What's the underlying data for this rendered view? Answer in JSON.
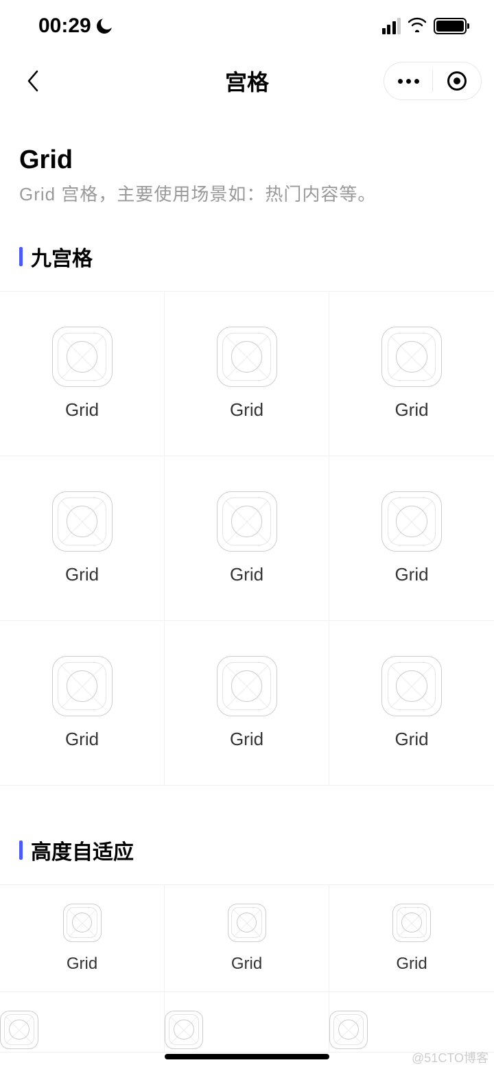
{
  "statusBar": {
    "time": "00:29"
  },
  "navBar": {
    "title": "宫格"
  },
  "intro": {
    "title": "Grid",
    "desc": "Grid 宫格，主要使用场景如：热门内容等。"
  },
  "sections": [
    {
      "title": "九宫格",
      "size": "large",
      "items": [
        {
          "label": "Grid"
        },
        {
          "label": "Grid"
        },
        {
          "label": "Grid"
        },
        {
          "label": "Grid"
        },
        {
          "label": "Grid"
        },
        {
          "label": "Grid"
        },
        {
          "label": "Grid"
        },
        {
          "label": "Grid"
        },
        {
          "label": "Grid"
        }
      ]
    },
    {
      "title": "高度自适应",
      "size": "small",
      "items": [
        {
          "label": "Grid"
        },
        {
          "label": "Grid"
        },
        {
          "label": "Grid"
        },
        {
          "label": ""
        },
        {
          "label": ""
        },
        {
          "label": ""
        }
      ]
    }
  ],
  "watermark": "@51CTO博客"
}
